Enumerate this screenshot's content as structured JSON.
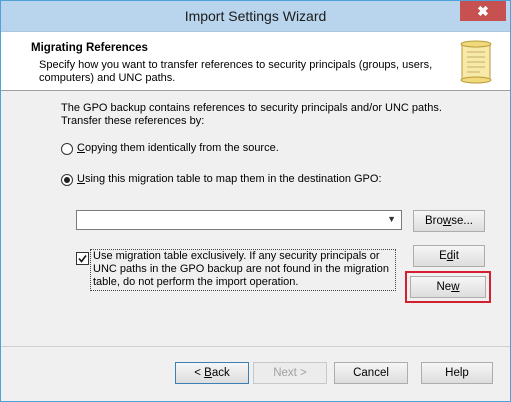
{
  "window": {
    "title": "Import Settings Wizard",
    "close_glyph": "✖"
  },
  "header": {
    "title": "Migrating References",
    "description": "Specify how you want to transfer references to security principals (groups, users, computers) and UNC paths.",
    "icon": "scroll-icon"
  },
  "content": {
    "intro": "The GPO backup contains references to security principals and/or UNC paths.  Transfer these references by:",
    "option_copy": {
      "accel": "C",
      "rest": "opying them identically from the source.",
      "selected": false
    },
    "option_migrate": {
      "accel": "U",
      "rest": "sing this migration table to map them in the destination GPO:",
      "selected": true
    },
    "migration_table_value": "",
    "browse": {
      "accel": "w",
      "before": "Bro",
      "after": "se..."
    },
    "edit": {
      "before": "E",
      "accel": "d",
      "after": "it"
    },
    "new": {
      "before": "Ne",
      "accel": "w",
      "after": ""
    },
    "exclusive_checkbox": {
      "checked": true,
      "label": "Use migration table exclusively.  If any security principals or UNC paths in the GPO backup are not found in the migration table, do not perform the import operation."
    }
  },
  "footer": {
    "back": {
      "before": "< ",
      "accel": "B",
      "after": "ack"
    },
    "next": "Next >",
    "cancel": "Cancel",
    "help": "Help"
  },
  "colors": {
    "highlight": "#d32030",
    "titlebar": "#b9d5ee"
  }
}
